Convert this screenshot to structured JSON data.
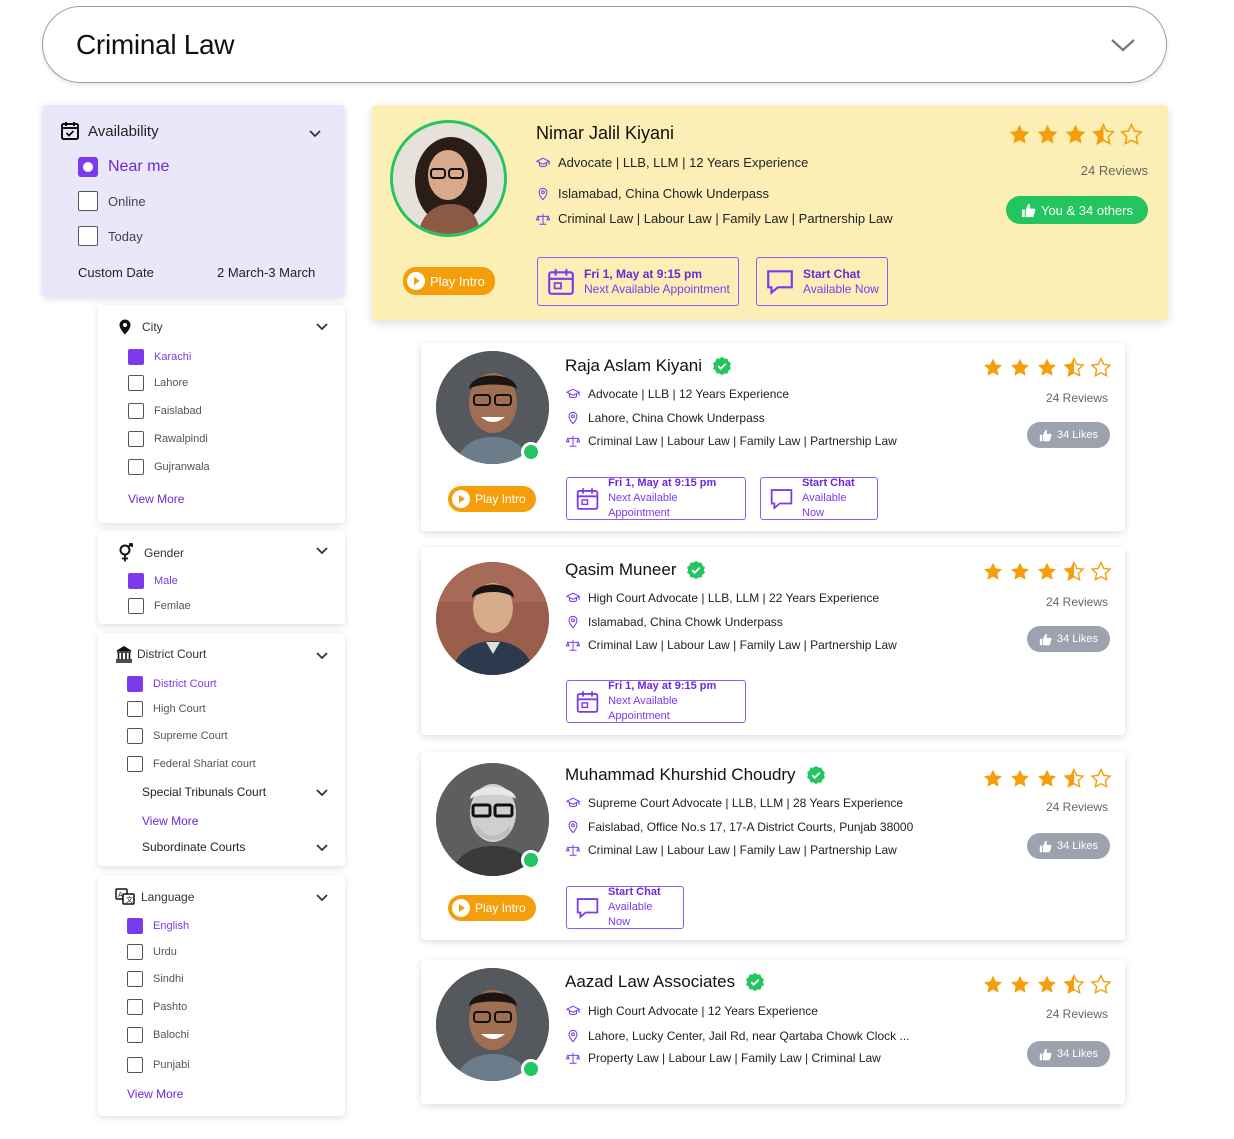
{
  "search": {
    "category": "Criminal Law"
  },
  "filters": {
    "availability": {
      "title": "Availability",
      "options": [
        "Near  me",
        "Online",
        "Today"
      ],
      "custom_date_label": "Custom Date",
      "custom_date_value": "2 March-3 March"
    },
    "city": {
      "title": "City",
      "options": [
        "Karachi",
        "Lahore",
        "Faislabad",
        "Rawalpindi",
        "Gujranwala"
      ],
      "view_more": "View More"
    },
    "gender": {
      "title": "Gender",
      "options": [
        "Male",
        "Femlae"
      ]
    },
    "court": {
      "title": "District Court",
      "options": [
        "District Court",
        "High Court",
        "Supreme Court",
        "Federal Shariat court"
      ],
      "special": "Special Tribunals Court",
      "view_more": "View More",
      "subordinate": "Subordinate Courts"
    },
    "language": {
      "title": "Language",
      "options": [
        "English",
        "Urdu",
        "Sindhi",
        "Pashto",
        "Balochi",
        "Punjabi"
      ],
      "view_more": "View More"
    }
  },
  "featured": {
    "name": "Nimar Jalil Kiyani",
    "title": "Advocate",
    "degrees": "LLB, LLM",
    "experience": "12 Years Experience",
    "location": "Islamabad, China Chowk Underpass",
    "practice": [
      "Criminal Law",
      "Labour Law",
      "Family Law",
      "Partnership Law"
    ],
    "rating": 3.5,
    "reviews": "24 Reviews",
    "likes": "You & 34 others",
    "play_intro": "Play Intro",
    "appointment_date": "Fri 1, May at 9:15 pm",
    "appointment_label": "Next Available Appointment",
    "chat_label": "Start Chat",
    "chat_status": "Available Now"
  },
  "lawyers": [
    {
      "name": "Raja Aslam Kiyani",
      "meta1": "Advocate | LLB | 12 Years Experience",
      "location": "Lahore, China Chowk Underpass",
      "practice": "Criminal Law  |  Labour Law  |  Family Law  |  Partnership Law",
      "reviews": "24 Reviews",
      "likes": "34 Likes",
      "play_intro": "Play Intro",
      "appointment_date": "Fri 1, May at 9:15 pm",
      "appointment_label": "Next Available Appointment",
      "chat_label": "Start Chat",
      "chat_status": "Available Now"
    },
    {
      "name": "Qasim Muneer",
      "meta1": "High Court Advocate | LLB, LLM | 22 Years Experience",
      "location": "Islamabad, China Chowk Underpass",
      "practice": "Criminal Law  |  Labour Law  |  Family Law  |  Partnership Law",
      "reviews": "24 Reviews",
      "likes": "34 Likes",
      "appointment_date": "Fri 1, May at 9:15 pm",
      "appointment_label": "Next Available Appointment"
    },
    {
      "name": "Muhammad Khurshid Choudry",
      "meta1": "Supreme Court Advocate | LLB, LLM | 28 Years Experience",
      "location": "Faislabad, Office No.s 17, 17-A District Courts, Punjab 38000",
      "practice": "Criminal Law  |  Labour Law  |  Family Law  |  Partnership Law",
      "reviews": "24 Reviews",
      "likes": "34 Likes",
      "play_intro": "Play Intro",
      "chat_label": "Start Chat",
      "chat_status": "Available Now"
    },
    {
      "name": "Aazad Law Associates",
      "meta1": "High Court Advocate | 12 Years Experience",
      "location": "Lahore, Lucky Center, Jail Rd, near Qartaba Chowk Clock ...",
      "practice": "Property Law  |  Labour Law  |  Family Law  |  Criminal Law",
      "reviews": "24 Reviews",
      "likes": "34 Likes"
    }
  ],
  "colors": {
    "accent": "#7c3aed",
    "star": "#f59e0b",
    "verified": "#22c55e",
    "featured_bg": "#fcefb6",
    "availability_bg": "#ebe7fb"
  }
}
